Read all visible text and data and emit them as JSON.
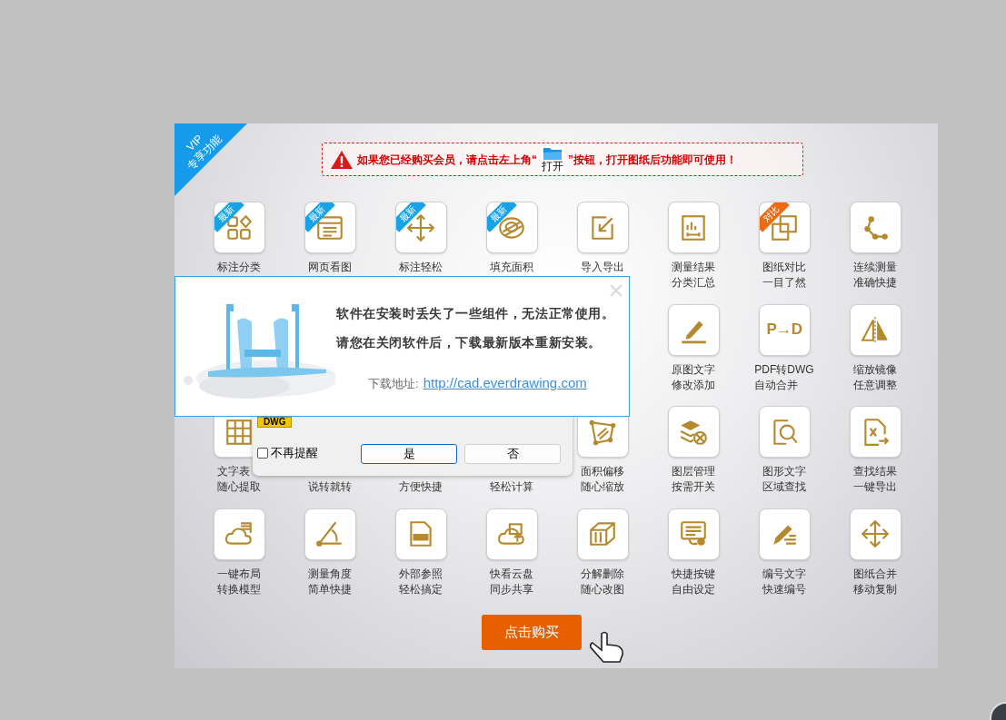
{
  "vip_ribbon": {
    "lines": [
      "VIP",
      "专享功能"
    ]
  },
  "notice": {
    "before": "如果您已经购买会员，请点击左上角“",
    "button_label": "打开",
    "after": "”按钮，打开图纸后功能即可使用！"
  },
  "features": [
    [
      {
        "top": "标注分类",
        "badge": {
          "text": "最新",
          "color": "#17a3e6"
        }
      },
      {
        "top": "网页看图",
        "badge": {
          "text": "最新",
          "color": "#17a3e6"
        }
      },
      {
        "top": "标注轻松",
        "badge": {
          "text": "最新",
          "color": "#17a3e6"
        }
      },
      {
        "top": "填充面积",
        "badge": {
          "text": "最新",
          "color": "#17a3e6"
        }
      },
      {
        "top": "导入导出"
      },
      {
        "top": "测量结果",
        "bottom": "分类汇总"
      },
      {
        "top": "图纸对比",
        "bottom": "一目了然",
        "badge": {
          "text": "对比",
          "color": "#ef6a12"
        }
      },
      {
        "top": "连续测量",
        "bottom": "准确快捷"
      }
    ],
    [
      {
        "top": "原图文字",
        "bottom": "修改添加"
      },
      {
        "top": "PDF转DWG",
        "bottom": "自动合并",
        "icon_text": "P→D"
      },
      {
        "top": "缩放镜像",
        "bottom": "任意调整"
      }
    ],
    [
      {
        "top": "文字表",
        "bottom": "随心提取"
      },
      {
        "bottom": "说转就转"
      },
      {
        "bottom": "方便快捷"
      },
      {
        "bottom": "轻松计算"
      },
      {
        "top": "面积偏移",
        "bottom": "随心缩放"
      },
      {
        "top": "图层管理",
        "bottom": "按需开关"
      },
      {
        "top": "图形文字",
        "bottom": "区域查找"
      },
      {
        "top": "查找结果",
        "bottom": "一键导出"
      }
    ],
    [
      {
        "top": "一键布局",
        "bottom": "转换模型"
      },
      {
        "top": "测量角度",
        "bottom": "简单快捷"
      },
      {
        "top": "外部参照",
        "bottom": "轻松搞定"
      },
      {
        "top": "快看云盘",
        "bottom": "同步共享"
      },
      {
        "top": "分解删除",
        "bottom": "随心改图"
      },
      {
        "top": "快捷按键",
        "bottom": "自由设定"
      },
      {
        "top": "编号文字",
        "bottom": "快速编号"
      },
      {
        "top": "图纸合并",
        "bottom": "移动复制"
      }
    ]
  ],
  "buy_button": {
    "label": "点击购买"
  },
  "dialog": {
    "badge": "DWG",
    "checkbox": {
      "label": "不再提醒",
      "checked": false
    },
    "buttons": [
      {
        "label": "是",
        "default": true
      },
      {
        "label": "否",
        "default": false
      }
    ]
  },
  "popup": {
    "lines": [
      "软件在安装时丢失了一些组件，无法正常使用。",
      "请您在关闭软件后，下载最新版本重新安装。"
    ],
    "download_label": "下载地址:",
    "link": "http://cad.everdrawing.com"
  }
}
